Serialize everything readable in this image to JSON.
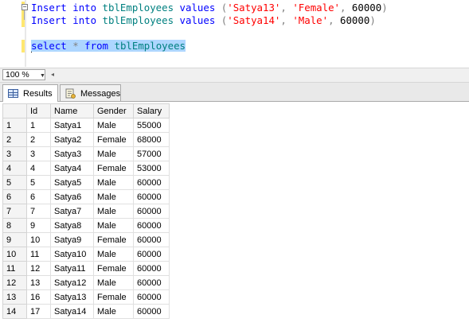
{
  "editor": {
    "line1": {
      "kw1": "Insert",
      "sp1": " ",
      "kw2": "into",
      "sp2": " ",
      "table": "tblEmployees",
      "sp3": " ",
      "kw3": "values",
      "sp4": " ",
      "open": "(",
      "v1": "'Satya13'",
      "c1": ", ",
      "v2": "'Female'",
      "c2": ", ",
      "v3": "60000",
      "close": ")"
    },
    "line2": {
      "kw1": "Insert",
      "sp1": " ",
      "kw2": "into",
      "sp2": " ",
      "table": "tblEmployees",
      "sp3": " ",
      "kw3": "values",
      "sp4": " ",
      "open": "(",
      "v1": "'Satya14'",
      "c1": ", ",
      "v2": "'Male'",
      "c2": ", ",
      "v3": "60000",
      "close": ")"
    },
    "line3": {
      "kw1": "select",
      "sp1": " ",
      "star": "*",
      "sp2": " ",
      "kw2": "from",
      "sp3": " ",
      "table": "tblEmployees"
    }
  },
  "zoom": {
    "value": "100 %"
  },
  "tabs": [
    {
      "label": "Results",
      "active": true,
      "icon": "grid-icon"
    },
    {
      "label": "Messages",
      "active": false,
      "icon": "messages-icon"
    }
  ],
  "results": {
    "columns": [
      "Id",
      "Name",
      "Gender",
      "Salary"
    ],
    "rows": [
      [
        "1",
        "1",
        "Satya1",
        "Male",
        "55000"
      ],
      [
        "2",
        "2",
        "Satya2",
        "Female",
        "68000"
      ],
      [
        "3",
        "3",
        "Satya3",
        "Male",
        "57000"
      ],
      [
        "4",
        "4",
        "Satya4",
        "Female",
        "53000"
      ],
      [
        "5",
        "5",
        "Satya5",
        "Male",
        "60000"
      ],
      [
        "6",
        "6",
        "Satya6",
        "Male",
        "60000"
      ],
      [
        "7",
        "7",
        "Satya7",
        "Male",
        "60000"
      ],
      [
        "8",
        "9",
        "Satya8",
        "Male",
        "60000"
      ],
      [
        "9",
        "10",
        "Satya9",
        "Female",
        "60000"
      ],
      [
        "10",
        "11",
        "Satya10",
        "Male",
        "60000"
      ],
      [
        "11",
        "12",
        "Satya11",
        "Female",
        "60000"
      ],
      [
        "12",
        "13",
        "Satya12",
        "Male",
        "60000"
      ],
      [
        "13",
        "16",
        "Satya13",
        "Female",
        "60000"
      ],
      [
        "14",
        "17",
        "Satya14",
        "Male",
        "60000"
      ]
    ]
  },
  "colors": {
    "keyword": "#0000ff",
    "string": "#ff0000",
    "identifier": "#008080",
    "selection": "#add6ff"
  }
}
